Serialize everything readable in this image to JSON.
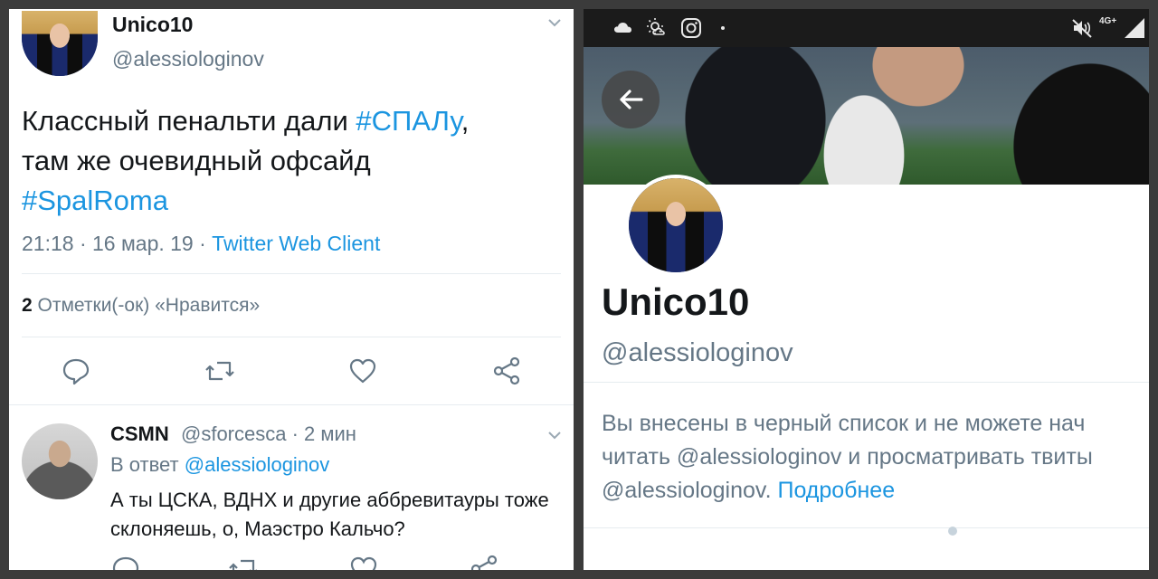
{
  "tweet": {
    "author_name": "Unico10",
    "author_handle": "@alessiologinov",
    "text_part1": "Классный пенальти дали ",
    "hashtag1": "#СПАЛу",
    "text_part2": ",",
    "text_line2": "там же очевидный офсайд",
    "hashtag2": "#SpalRoma",
    "time": "21:18 · 16 мар. 19 · ",
    "client": "Twitter Web Client",
    "likes_count": "2",
    "likes_label": " Отметки(-ок) «Нравится»",
    "actions": [
      "reply-icon",
      "retweet-icon",
      "like-icon",
      "share-icon"
    ]
  },
  "reply": {
    "author_name": "CSMN",
    "author_handle": "@sforcesca · 2 мин",
    "reply_prefix": "В ответ ",
    "reply_to": "@alessiologinov",
    "text": "А ты ЦСКА, ВДНХ и другие аббревитауры тоже склоняешь, о, Маэстро Кальчо?"
  },
  "profile": {
    "status_icons": [
      "cloud-icon",
      "weather-icon",
      "instagram-icon",
      "dot-icon",
      "mute-icon",
      "signal-icon"
    ],
    "signal_label": "4G+",
    "name": "Unico10",
    "handle": "@alessiologinov",
    "blocked_line1": "Вы внесены в черный список и не можете нач",
    "blocked_line2": "читать @alessiologinov и просматривать твиты",
    "blocked_line3": "@alessiologinov. ",
    "learn_more": "Подробнее",
    "accent": "#1b95e0"
  }
}
